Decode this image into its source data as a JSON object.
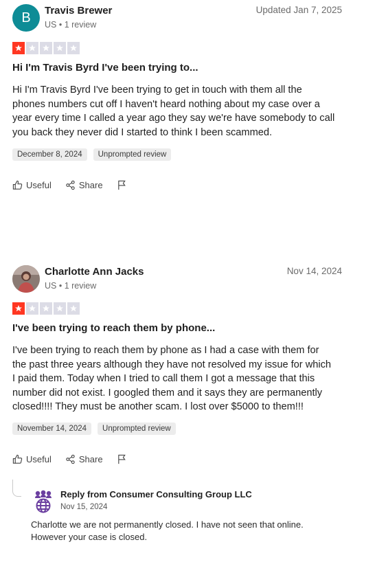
{
  "reviews": [
    {
      "reviewer_name": "Travis Brewer",
      "avatar_initial": "B",
      "country": "US",
      "review_count": "1 review",
      "date": "Updated Jan 7, 2025",
      "rating": 1,
      "title": "Hi I'm Travis Byrd I've been trying to...",
      "body_lines": [
        "Hi I'm Travis Byrd I've been trying to get in touch with them all the",
        "phones numbers cut off I haven't heard nothing about my case over a",
        "year every time I called a year ago they say we're have somebody to call",
        "you back they never did I started to think I been scammed."
      ],
      "tags": [
        "December 8, 2024",
        "Unprompted review"
      ],
      "actions": {
        "useful": "Useful",
        "share": "Share"
      }
    },
    {
      "reviewer_name": "Charlotte Ann Jacks",
      "country": "US",
      "review_count": "1 review",
      "date": "Nov 14, 2024",
      "rating": 1,
      "title": "I've been trying to reach them by phone...",
      "body_lines": [
        "I've been trying to reach them by phone as I had a case with them for",
        "the past three years although they have not resolved my issue for which",
        "I paid them. Today when I tried to call them I got a message that this",
        "number did not exist. I googled them and it says they are permanently",
        "closed!!!! They must be another scam. I lost over $5000 to them!!!"
      ],
      "tags": [
        "November 14, 2024",
        "Unprompted review"
      ],
      "actions": {
        "useful": "Useful",
        "share": "Share"
      },
      "reply": {
        "from": "Reply from Consumer Consulting Group LLC",
        "date": "Nov 15, 2024",
        "text_lines": [
          "Charlotte we are not permanently closed. I have not seen that online.",
          "However your case is closed."
        ]
      }
    }
  ],
  "colors": {
    "star_on": "#ff3722",
    "star_off": "#dcdce6",
    "avatar_teal": "#0e8c96",
    "reply_logo": "#6b3fa0"
  }
}
